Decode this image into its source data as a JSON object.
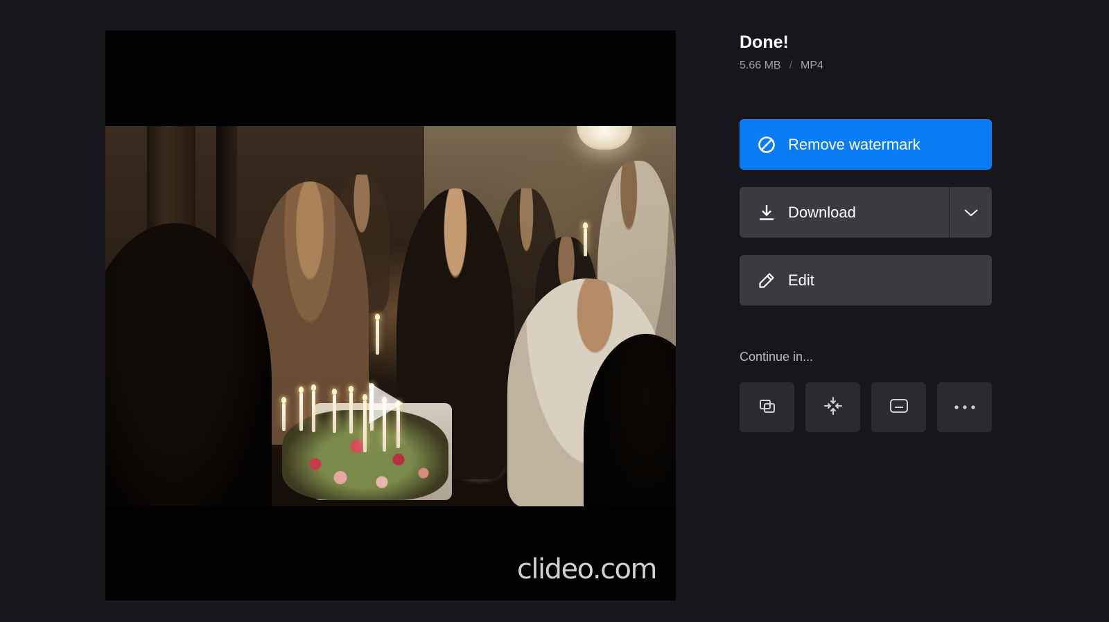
{
  "result": {
    "title": "Done!",
    "file_size": "5.66 MB",
    "separator": "/",
    "format": "MP4"
  },
  "actions": {
    "remove_watermark_label": "Remove watermark",
    "download_label": "Download",
    "edit_label": "Edit"
  },
  "continue": {
    "label": "Continue in...",
    "tools": [
      {
        "icon": "layers-icon"
      },
      {
        "icon": "compress-icon"
      },
      {
        "icon": "subtitles-icon"
      },
      {
        "icon": "more-icon"
      }
    ]
  },
  "player": {
    "watermark": "clideo.com"
  },
  "colors": {
    "background": "#17171b",
    "accent": "#0a7cf5",
    "button": "#3a3b41",
    "tool_button": "#2a2b30"
  }
}
